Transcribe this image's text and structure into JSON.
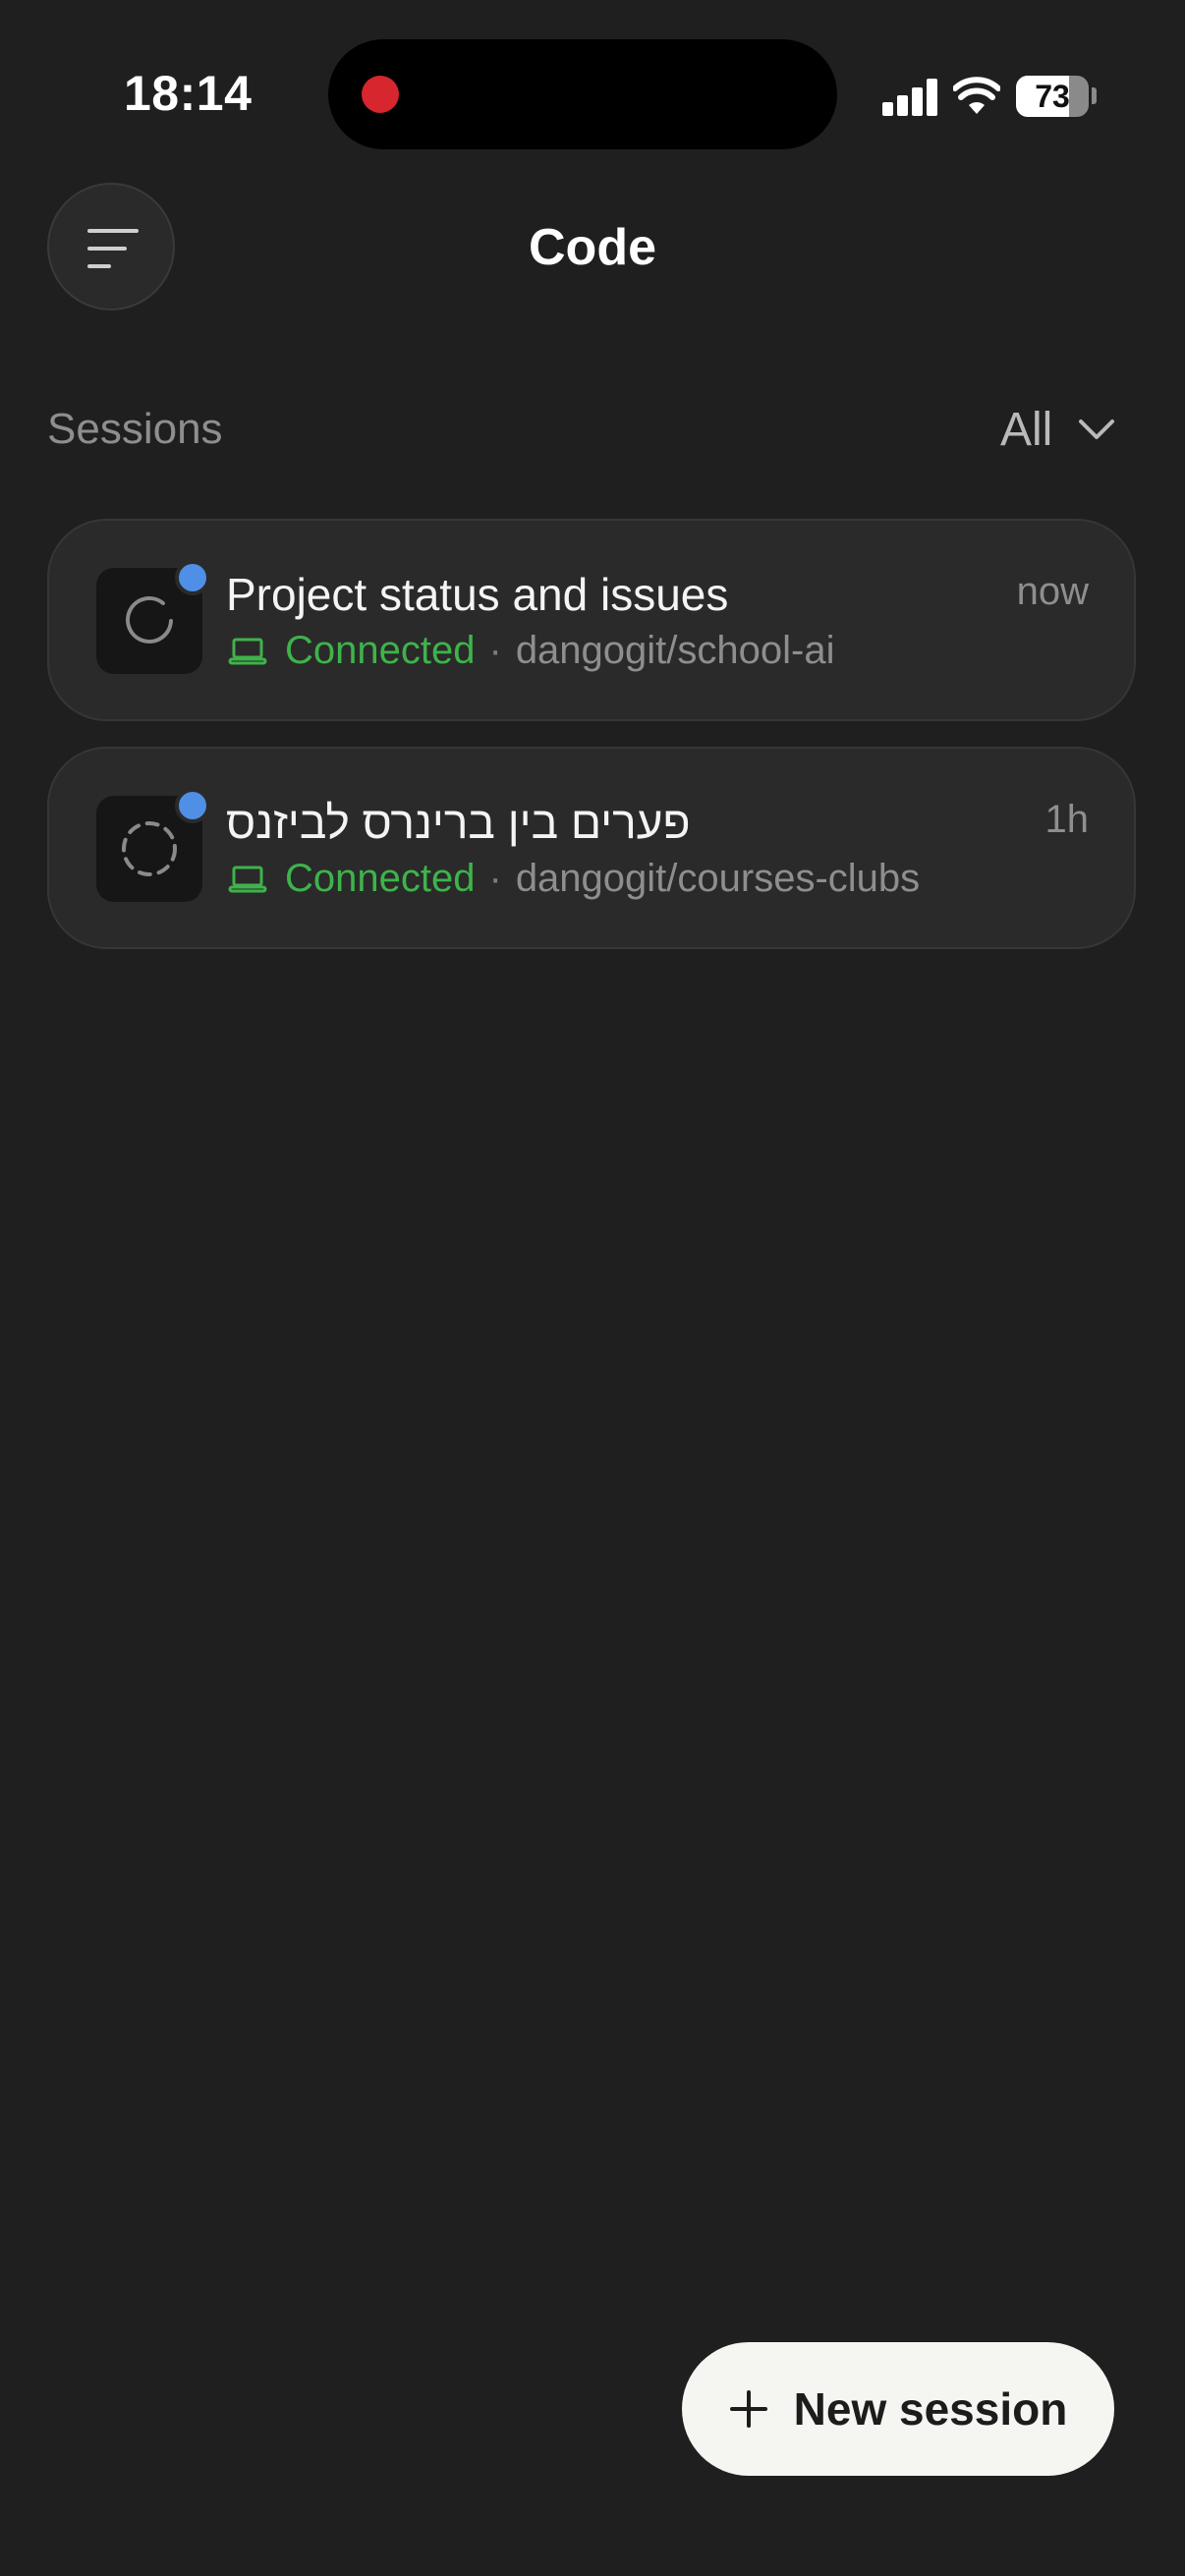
{
  "status_bar": {
    "time": "18:14",
    "battery_percent": "73",
    "battery_level": 0.73,
    "recording_color": "#d7262e"
  },
  "header": {
    "title": "Code",
    "menu_icon": "menu-icon"
  },
  "sessions": {
    "label": "Sessions",
    "filter_label": "All",
    "items": [
      {
        "title": "Project status and issues",
        "time": "now",
        "status": "Connected",
        "separator": "·",
        "repo": "dangogit/school-ai",
        "icon": "spinner-icon",
        "unread": true
      },
      {
        "title": "פערים בין ברינרס לביזנס",
        "time": "1h",
        "status": "Connected",
        "separator": "·",
        "repo": "dangogit/courses-clubs",
        "icon": "dashed-circle-icon",
        "unread": true
      }
    ]
  },
  "actions": {
    "new_session_label": "New session"
  },
  "colors": {
    "background": "#1f1f1f",
    "card": "#2a2a2a",
    "connected": "#3eb34b",
    "unread_dot": "#4f8fe6",
    "button_bg": "#f5f5f1"
  }
}
